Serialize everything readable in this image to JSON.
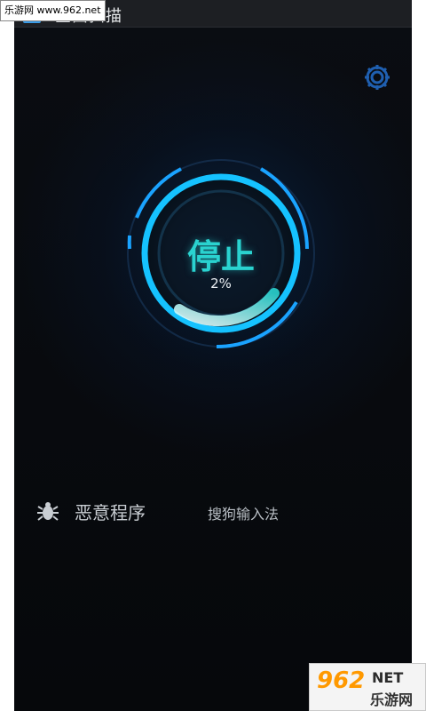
{
  "watermark_top": "乐游网 www.962.net",
  "app": {
    "title": "全面扫描"
  },
  "scan": {
    "button_label": "停止",
    "progress_text": "2%",
    "progress_fraction": 0.02
  },
  "results": [
    {
      "category": "恶意程序",
      "item": "搜狗输入法"
    }
  ],
  "watermark_bottom": {
    "brand": "962",
    "net": "NET",
    "site": "乐游网"
  },
  "colors": {
    "accent": "#2ad3d0",
    "ring_blue": "#1aa3ff",
    "background": "#07090c"
  },
  "icons": {
    "settings": "gear-icon",
    "category": "bug-icon"
  }
}
